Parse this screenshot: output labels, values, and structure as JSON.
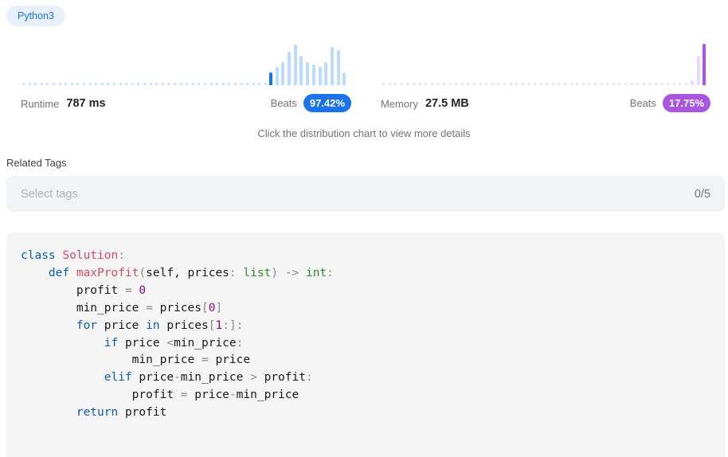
{
  "language_chip": "Python3",
  "runtime": {
    "label": "Runtime",
    "value": "787 ms",
    "beats_label": "Beats",
    "beats_percent": "97.42%",
    "color": "#1a73e8",
    "bar_color": "#bcdcff",
    "selected_color": "#1a73e8",
    "distribution_levels": [
      0.3,
      0.45,
      0.55,
      0.8,
      0.98,
      0.72,
      0.55,
      0.5,
      0.45,
      0.55,
      0.92,
      0.85,
      0.3
    ]
  },
  "memory": {
    "label": "Memory",
    "value": "27.5 MB",
    "beats_label": "Beats",
    "beats_percent": "17.75%",
    "color": "#a855e0",
    "bar_color": "#ecd6fb",
    "selected_color": "#a855e0",
    "distribution_levels": [
      0.12,
      0.72,
      1.0
    ]
  },
  "hint": "Click the distribution chart to view more details",
  "related_tags": {
    "label": "Related Tags",
    "placeholder": "Select tags",
    "count": "0/5"
  },
  "code": [
    [
      {
        "t": "class ",
        "c": "kw"
      },
      {
        "t": "Solution",
        "c": "cls"
      },
      {
        "t": ":",
        "c": "op"
      }
    ],
    [
      {
        "t": "    def ",
        "c": "kw"
      },
      {
        "t": "maxProfit",
        "c": "fn"
      },
      {
        "t": "(",
        "c": "op"
      },
      {
        "t": "self, prices",
        "c": ""
      },
      {
        "t": ": ",
        "c": "op"
      },
      {
        "t": "list",
        "c": "typ"
      },
      {
        "t": ") -> ",
        "c": "op"
      },
      {
        "t": "int",
        "c": "typ"
      },
      {
        "t": ":",
        "c": "op"
      }
    ],
    [
      {
        "t": "        profit ",
        "c": ""
      },
      {
        "t": "= ",
        "c": "op"
      },
      {
        "t": "0",
        "c": "num"
      }
    ],
    [
      {
        "t": "        min_price ",
        "c": ""
      },
      {
        "t": "= ",
        "c": "op"
      },
      {
        "t": "prices",
        "c": ""
      },
      {
        "t": "[",
        "c": "op"
      },
      {
        "t": "0",
        "c": "num"
      },
      {
        "t": "]",
        "c": "op"
      }
    ],
    [
      {
        "t": "        for ",
        "c": "kw"
      },
      {
        "t": "price ",
        "c": ""
      },
      {
        "t": "in ",
        "c": "kw"
      },
      {
        "t": "prices",
        "c": ""
      },
      {
        "t": "[",
        "c": "op"
      },
      {
        "t": "1",
        "c": "num"
      },
      {
        "t": ":]:",
        "c": "op"
      }
    ],
    [
      {
        "t": "            if ",
        "c": "kw"
      },
      {
        "t": "price ",
        "c": ""
      },
      {
        "t": "<",
        "c": "op"
      },
      {
        "t": "min_price",
        "c": ""
      },
      {
        "t": ":",
        "c": "op"
      }
    ],
    [
      {
        "t": "                min_price ",
        "c": ""
      },
      {
        "t": "= ",
        "c": "op"
      },
      {
        "t": "price",
        "c": ""
      }
    ],
    [
      {
        "t": "            elif ",
        "c": "kw"
      },
      {
        "t": "price",
        "c": ""
      },
      {
        "t": "-",
        "c": "op"
      },
      {
        "t": "min_price ",
        "c": ""
      },
      {
        "t": "> ",
        "c": "op"
      },
      {
        "t": "profit",
        "c": ""
      },
      {
        "t": ":",
        "c": "op"
      }
    ],
    [
      {
        "t": "                profit ",
        "c": ""
      },
      {
        "t": "= ",
        "c": "op"
      },
      {
        "t": "price",
        "c": ""
      },
      {
        "t": "-",
        "c": "op"
      },
      {
        "t": "min_price",
        "c": ""
      }
    ],
    [
      {
        "t": "        return ",
        "c": "kw"
      },
      {
        "t": "profit",
        "c": ""
      }
    ]
  ]
}
